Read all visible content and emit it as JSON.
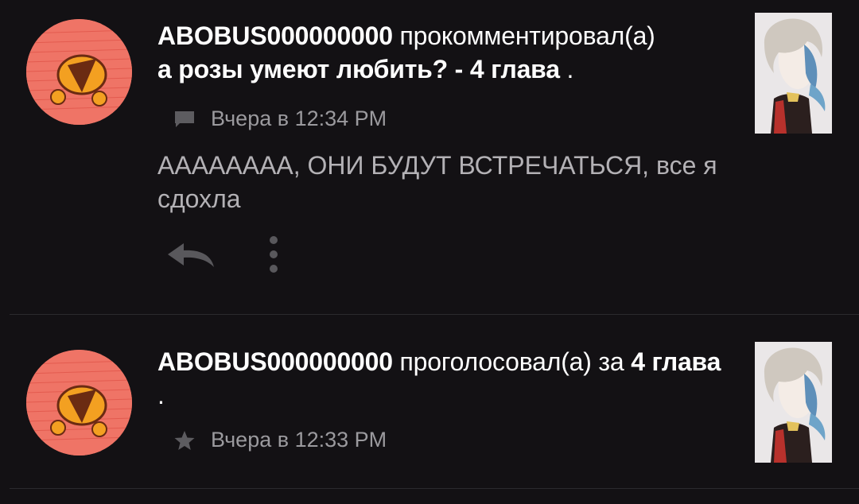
{
  "notifications": [
    {
      "username": "ABOBUS000000000",
      "action": " прокомментировал(а)",
      "work_title": "а розы умеют любить? - 4 глава",
      "suffix": " .",
      "meta_icon": "comment-icon",
      "timestamp": "Вчера в 12:34 PM",
      "comment": "АААААААА, ОНИ БУДУТ ВСТРЕЧАТЬСЯ, все я сдохла",
      "actions": [
        "reply-icon",
        "more-vertical-icon"
      ]
    },
    {
      "username": "ABOBUS000000000",
      "action": " проголосовал(а) за ",
      "work_title": "4 глава",
      "suffix": " .",
      "meta_icon": "star-icon",
      "timestamp": "Вчера в 12:33 PM"
    }
  ],
  "colors": {
    "background": "#131114",
    "avatar": "#ef7466",
    "meta_text": "#9b9a9e",
    "comment_text": "#b3b1b5",
    "divider": "#2b2a2e"
  }
}
